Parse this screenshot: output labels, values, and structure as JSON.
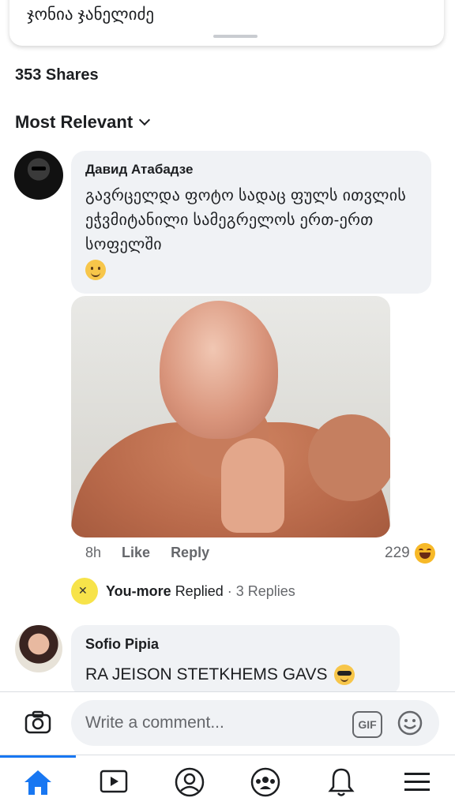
{
  "top_card": {
    "author": "ჯონია ჯანელიძე"
  },
  "post_stats": {
    "shares": "353 Shares"
  },
  "sort": {
    "label": "Most Relevant"
  },
  "comments": [
    {
      "author": "Давид Атабадзе",
      "text": "გავრცელდა ფოტო სადაც ფულს ითვლის ეჭვმიტანილი სამეგრელოს ერთ-ერთ სოფელში",
      "time": "8h",
      "like_label": "Like",
      "reply_label": "Reply",
      "reaction_count": "229",
      "reaction_icon": "laughing-face-icon",
      "replies": {
        "replier": "You-more",
        "action": "Replied",
        "separator": "·",
        "count": "3 Replies"
      }
    },
    {
      "author": "Sofio Pipia",
      "text": "RA JEISON STETKHEMS GAVS",
      "emoji": "sunglasses-face-icon"
    }
  ],
  "composer": {
    "placeholder": "Write a comment...",
    "gif_label": "GIF"
  },
  "nav": [
    "home-icon",
    "video-icon",
    "profile-icon",
    "groups-icon",
    "notifications-icon",
    "menu-icon"
  ],
  "colors": {
    "accent": "#1877f2",
    "bubble": "#f0f2f5",
    "secondary_text": "#65676b"
  }
}
